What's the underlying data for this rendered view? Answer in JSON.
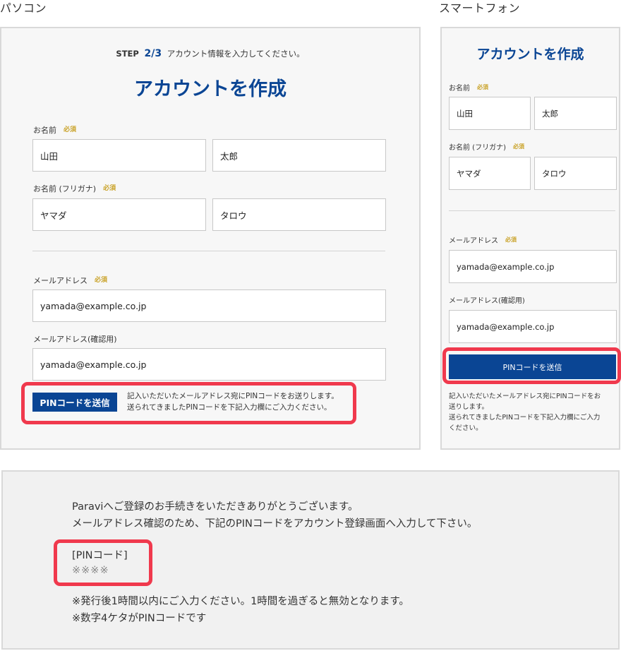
{
  "captions": {
    "pc": "パソコン",
    "sp": "スマートフォン"
  },
  "pc": {
    "step_prefix": "STEP",
    "step_num": "2/3",
    "step_text": "アカウント情報を入力してください。",
    "title": "アカウントを作成",
    "name_label": "お名前",
    "kana_label": "お名前 (フリガナ)",
    "email_label": "メールアドレス",
    "email_confirm_label": "メールアドレス(確認用)",
    "required": "必須",
    "last_name": "山田",
    "first_name": "太郎",
    "last_kana": "ヤマダ",
    "first_kana": "タロウ",
    "email": "yamada@example.co.jp",
    "email_confirm": "yamada@example.co.jp",
    "pin_button": "PINコードを送信",
    "pin_note_1": "記入いただいたメールアドレス宛にPINコードをお送りします。",
    "pin_note_2": "送られてきましたPINコードを下記入力欄にご入力ください。"
  },
  "sp": {
    "title": "アカウントを作成",
    "name_label": "お名前",
    "kana_label": "お名前 (フリガナ)",
    "email_label": "メールアドレス",
    "email_confirm_label": "メールアドレス(確認用)",
    "required": "必須",
    "last_name": "山田",
    "first_name": "太郎",
    "last_kana": "ヤマダ",
    "first_kana": "タロウ",
    "email": "yamada@example.co.jp",
    "email_confirm": "yamada@example.co.jp",
    "pin_button": "PINコードを送信",
    "note_1": "記入いただいたメールアドレス宛にPINコードをお",
    "note_2": "送りします。",
    "note_3": "送られてきましたPINコードを下記入力欄にご入力",
    "note_4": "ください。"
  },
  "mail": {
    "line1": "Paraviへご登録のお手続きをいただきありがとうございます。",
    "line2": "メールアドレス確認のため、下記のPINコードをアカウント登録画面へ入力して下さい。",
    "pin_label": "[PINコード]",
    "pin_value": "※※※※",
    "note1": "※発行後1時間以内にご入力ください。1時間を過ぎると無効となります。",
    "note2": "※数字4ケタがPINコードです"
  },
  "colors": {
    "brand": "#0a4594",
    "required": "#c9a227",
    "highlight": "#f0394d"
  }
}
